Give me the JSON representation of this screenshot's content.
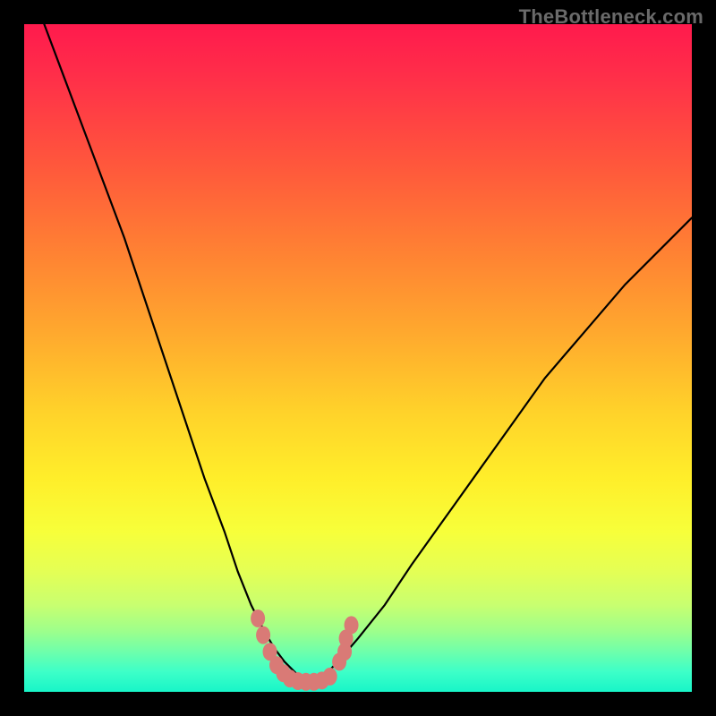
{
  "watermark": "TheBottleneck.com",
  "colors": {
    "page_bg": "#000000",
    "marker_fill": "#d97a76",
    "curve_stroke": "#000000",
    "gradient_stops": [
      "#ff1a4d",
      "#ff5a3b",
      "#ffa82e",
      "#ffee2a",
      "#c8ff70",
      "#3dffc8",
      "#18f5c8"
    ]
  },
  "chart_data": {
    "type": "line",
    "title": "",
    "xlabel": "",
    "ylabel": "",
    "xlim": [
      0,
      100
    ],
    "ylim": [
      0,
      100
    ],
    "grid": false,
    "legend": false,
    "notes": "Axes are unlabeled in the image; values are approximate percentages of the plot area (0 = left/bottom, 100 = right/top). Two black curves descend from the upper corners to a minimum near the bottom-center, then rise; a cluster of salmon-pink dotted markers sits along the trough.",
    "series": [
      {
        "name": "left_curve",
        "x": [
          3,
          6,
          9,
          12,
          15,
          18,
          21,
          24,
          27,
          30,
          32,
          34,
          36,
          37.5,
          39,
          41,
          43
        ],
        "y": [
          100,
          92,
          84,
          76,
          68,
          59,
          50,
          41,
          32,
          24,
          18,
          13,
          9,
          6.5,
          4.5,
          2.5,
          1.5
        ]
      },
      {
        "name": "right_curve",
        "x": [
          43,
          45,
          47,
          50,
          54,
          58,
          63,
          68,
          73,
          78,
          84,
          90,
          96,
          100
        ],
        "y": [
          1.5,
          2.5,
          4.5,
          8,
          13,
          19,
          26,
          33,
          40,
          47,
          54,
          61,
          67,
          71
        ]
      }
    ],
    "markers": {
      "name": "highlight_cluster",
      "type": "scatter",
      "shape": "rounded",
      "color": "#d97a76",
      "points": [
        {
          "x": 35.0,
          "y": 11.0
        },
        {
          "x": 35.8,
          "y": 8.5
        },
        {
          "x": 36.8,
          "y": 6.0
        },
        {
          "x": 37.8,
          "y": 4.0
        },
        {
          "x": 38.8,
          "y": 2.8
        },
        {
          "x": 39.8,
          "y": 2.0
        },
        {
          "x": 41.0,
          "y": 1.6
        },
        {
          "x": 42.2,
          "y": 1.5
        },
        {
          "x": 43.4,
          "y": 1.5
        },
        {
          "x": 44.6,
          "y": 1.7
        },
        {
          "x": 45.8,
          "y": 2.3
        },
        {
          "x": 47.2,
          "y": 4.5
        },
        {
          "x": 48.0,
          "y": 6.0
        },
        {
          "x": 48.2,
          "y": 8.0
        },
        {
          "x": 49.0,
          "y": 10.0
        }
      ]
    }
  }
}
